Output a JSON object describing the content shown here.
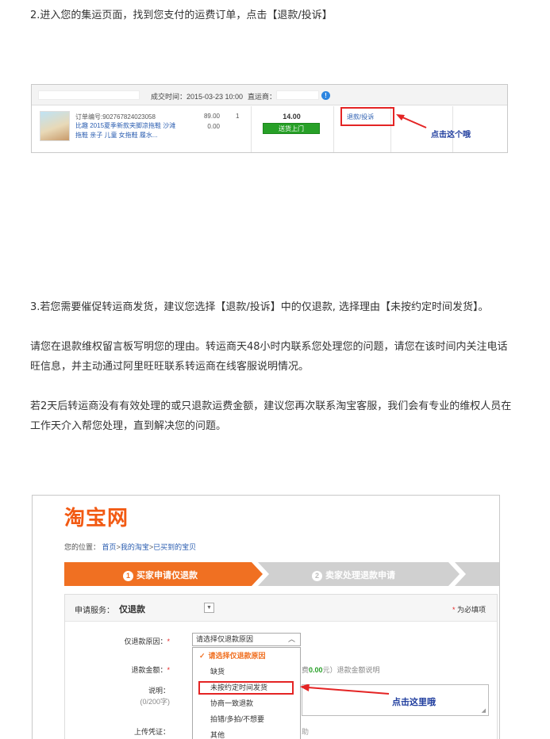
{
  "paragraphs": {
    "step2": "2.进入您的集运页面，找到您支付的运费订单，点击【退款/投诉】",
    "step3": "3.若您需要催促转运商发货，建议您选择【退款/投诉】中的仅退款, 选择理由【未按约定时间发货】。",
    "reason1_line1": "  请您在退款维权留言板写明您的理由。转运商天48小时内联系您处理您的问题，请您在该时间内关注电话",
    "reason1_line2": "旺信息，并主动通过阿里旺旺联系转运商在线客服说明情况。",
    "reason2_line1": "  若2天后转运商没有有效处理的或只退款运费金额，建议您再次联系淘宝客服，我们会有专业的维权人员在",
    "reason2_line2": "工作天介入帮您处理，直到解决您的问题。"
  },
  "order_screenshot": {
    "deal_time_label": "成交时间：2015-03-23 10:00",
    "supplier_label": "直运商：",
    "info_icon": "info-icon",
    "order_no": "订单编号:902767824023058",
    "item_title": "比趣 2015夏季新款夹脚凉拖鞋 沙滩拖鞋 亲子 儿童 女拖鞋 履水...",
    "price": "89.00",
    "discount": "0.00",
    "qty": "1",
    "freight": "14.00",
    "deliver_button": "送货上门",
    "refund_link": "退款/投诉",
    "click_tip": "点击这个哦",
    "colors": {
      "highlight": "#e42424",
      "deliver": "#27a027",
      "tip": "#1f3d9e"
    }
  },
  "refund_screenshot": {
    "logo": "淘宝网",
    "breadcrumb": {
      "prefix": "您的位置：",
      "items": [
        "首页",
        "我的淘宝",
        "已买到的宝贝"
      ],
      "sep": ">"
    },
    "steps": [
      {
        "num": "1",
        "label": "买家申请仅退款",
        "active": true
      },
      {
        "num": "2",
        "label": "卖家处理退款申请",
        "active": false
      }
    ],
    "service_label": "申请服务：",
    "service_value": "仅退款",
    "required_note": "为必填项",
    "required_star": "*",
    "reason_label": "仅退款原因：",
    "reason_placeholder": "请选择仅退款原因",
    "reason_options": [
      {
        "label": "请选择仅退款原因",
        "selected": true
      },
      {
        "label": "缺货",
        "selected": false
      },
      {
        "label": "未按约定时间发货",
        "selected": false
      },
      {
        "label": "协商一致退款",
        "selected": false
      },
      {
        "label": "拍错/多拍/不想要",
        "selected": false
      },
      {
        "label": "其他",
        "selected": false
      }
    ],
    "amount_label": "退款金额：",
    "amount_tail_prefix": "费",
    "amount_value": "0.00",
    "amount_tail_suffix": "元）退款金额说明",
    "note_label": "说明：",
    "note_counter": "(0/200字)",
    "upload_label": "上传凭证：",
    "upload_hint": "助",
    "click_here": "点击这里哦",
    "colors": {
      "orange": "#f07022",
      "highlight": "#e42424",
      "tip": "#1f3d9e"
    }
  }
}
